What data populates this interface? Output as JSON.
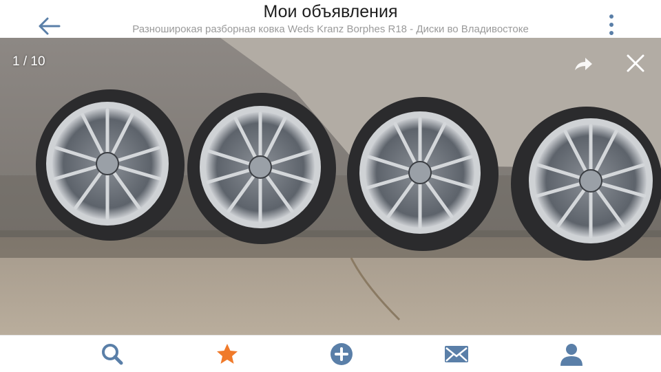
{
  "header": {
    "title": "Мои объявления",
    "subtitle": "Разноширокая разборная ковка Weds Kranz Borphes R18 - Диски во Владивостоке",
    "back_icon": "arrow-left-icon",
    "menu_icon": "vertical-dots-icon"
  },
  "gallery": {
    "counter": "1 / 10",
    "share_icon": "share-arrow-icon",
    "close_icon": "close-icon"
  },
  "tabbar": {
    "items": [
      {
        "name": "search",
        "icon": "magnifier-icon",
        "color": "#5a7fa8"
      },
      {
        "name": "favorites",
        "icon": "star-icon",
        "color": "#f07a2a"
      },
      {
        "name": "add",
        "icon": "plus-circle-icon",
        "color": "#5a7fa8"
      },
      {
        "name": "messages",
        "icon": "envelope-icon",
        "color": "#5a7fa8"
      },
      {
        "name": "profile",
        "icon": "user-icon",
        "color": "#5a7fa8"
      }
    ]
  },
  "colors": {
    "accent": "#5a7fa8",
    "favorite": "#f07a2a"
  }
}
